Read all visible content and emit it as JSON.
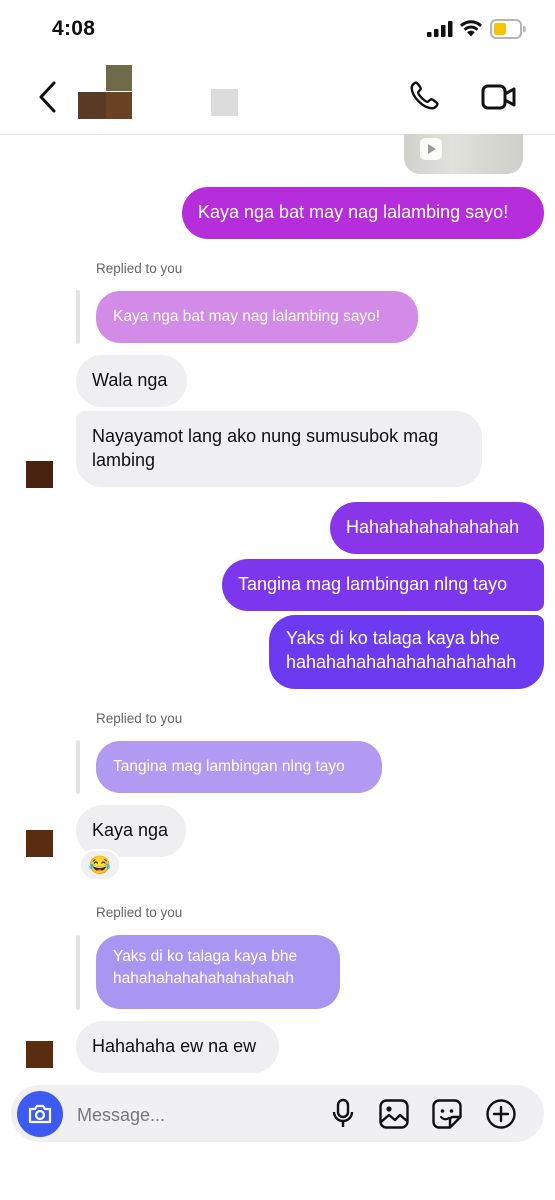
{
  "status_bar": {
    "time": "4:08"
  },
  "header": {
    "contact_name_redacted": true
  },
  "messages": [
    {
      "id": "m1",
      "text": "Kaya nga bat may nag lalambing sayo!"
    },
    {
      "id": "m2_reply_label",
      "text": "Replied to you"
    },
    {
      "id": "m2_quote",
      "text": "Kaya nga bat may nag lalambing sayo!"
    },
    {
      "id": "m3",
      "text": "Wala nga"
    },
    {
      "id": "m4",
      "text": "Nayayamot lang ako nung sumusubok mag lambing"
    },
    {
      "id": "m5",
      "text": "Hahahahahahahahah"
    },
    {
      "id": "m6",
      "text": "Tangina mag lambingan nlng tayo"
    },
    {
      "id": "m7",
      "text": "Yaks di ko talaga kaya bhe hahahahahahahahahahahah"
    },
    {
      "id": "m8_reply_label",
      "text": "Replied to you"
    },
    {
      "id": "m8_quote",
      "text": "Tangina mag lambingan nlng tayo"
    },
    {
      "id": "m9",
      "text": "Kaya nga"
    },
    {
      "id": "m9_reaction",
      "text": "😂"
    },
    {
      "id": "m10_reply_label",
      "text": "Replied to you"
    },
    {
      "id": "m10_quote",
      "text": "Yaks di ko talaga kaya bhe hahahahahahahahahahah"
    },
    {
      "id": "m11",
      "text": "Hahahaha ew na ew"
    }
  ],
  "composer": {
    "placeholder": "Message..."
  },
  "icons": {
    "back": "chevron-left-icon",
    "phone": "phone-icon",
    "video": "video-camera-icon",
    "camera": "camera-icon",
    "mic": "microphone-icon",
    "gallery": "image-icon",
    "sticker": "sticker-icon",
    "plus": "plus-circle-icon"
  },
  "colors": {
    "accent_blue": "#3d5af1",
    "bubble_magenta": "#b52fdd",
    "bubble_purple": "#7a36ef",
    "bubble_incoming": "#efeff2"
  }
}
